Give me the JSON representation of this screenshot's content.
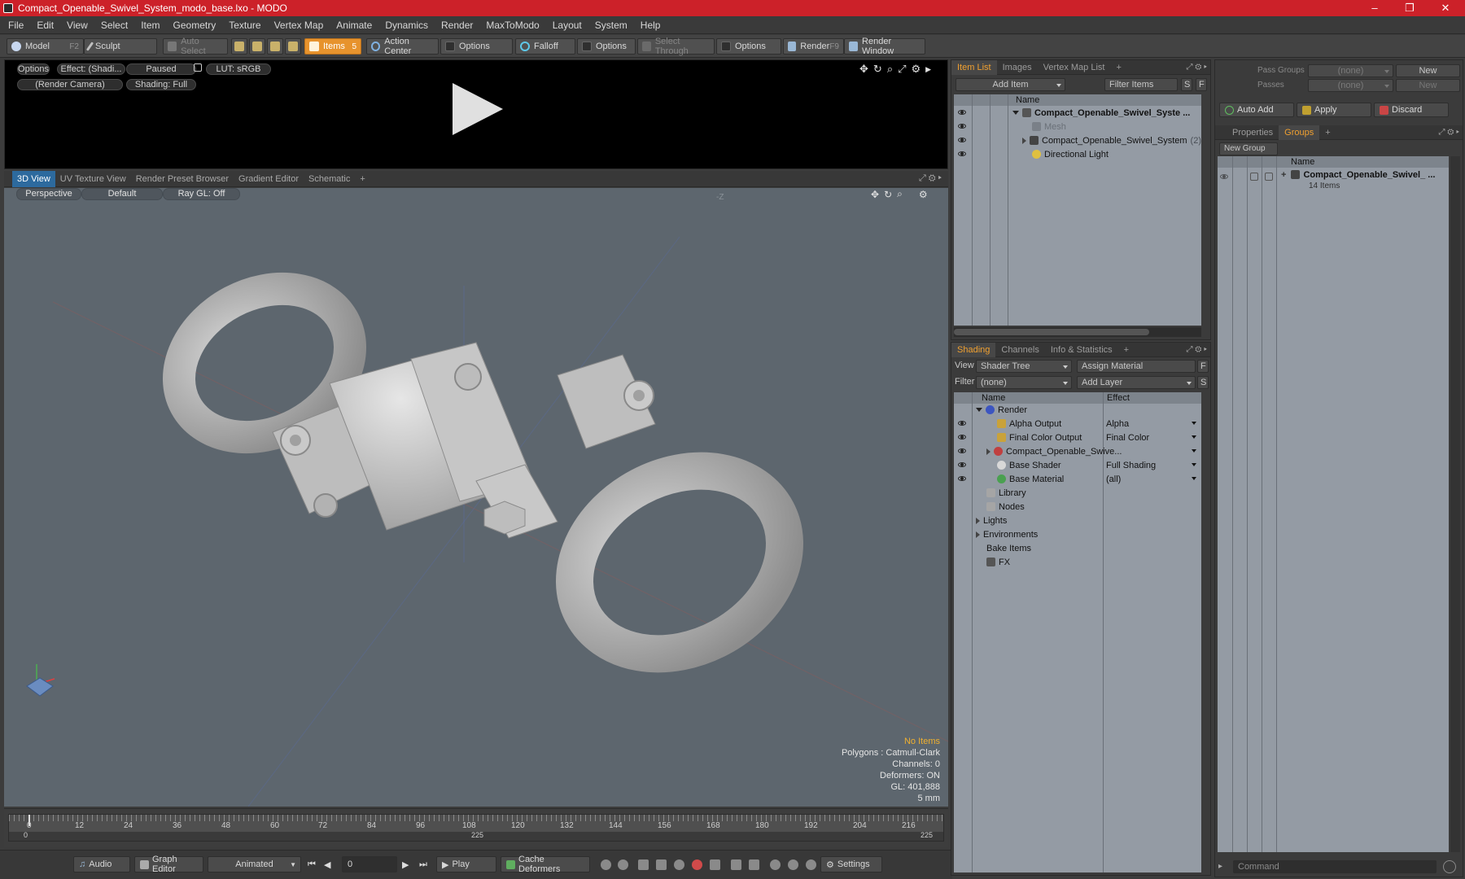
{
  "window": {
    "title": "Compact_Openable_Swivel_System_modo_base.lxo - MODO",
    "controls": [
      "–",
      "❐",
      "✕"
    ]
  },
  "menu": [
    "File",
    "Edit",
    "View",
    "Select",
    "Item",
    "Geometry",
    "Texture",
    "Vertex Map",
    "Animate",
    "Dynamics",
    "Render",
    "MaxToModo",
    "Layout",
    "System",
    "Help"
  ],
  "toolbar": {
    "model": "Model",
    "model_key": "F2",
    "sculpt": "Sculpt",
    "auto_select": "Auto Select",
    "items": "Items",
    "items_key": "5",
    "action_center": "Action Center",
    "options1": "Options",
    "falloff": "Falloff",
    "options2": "Options",
    "select_through": "Select Through",
    "options3": "Options",
    "render": "Render",
    "render_key": "F9",
    "render_window": "Render Window"
  },
  "preview": {
    "options": "Options",
    "effect": "Effect: (Shadi...",
    "paused": "Paused",
    "lut": "LUT: sRGB",
    "camera": "(Render Camera)",
    "shading": "Shading: Full"
  },
  "view_tabs": [
    "3D View",
    "UV Texture View",
    "Render Preset Browser",
    "Gradient Editor",
    "Schematic",
    "+"
  ],
  "viewport": {
    "perspective": "Perspective",
    "default": "Default",
    "raygl": "Ray GL: Off",
    "axis_label": "-Z",
    "stats": {
      "no_items": "No Items",
      "polygons": "Polygons : Catmull-Clark",
      "channels": "Channels: 0",
      "deformers": "Deformers: ON",
      "gl": "GL: 401,888",
      "scale": "5 mm"
    }
  },
  "timeline": {
    "ticks": [
      "0",
      "12",
      "24",
      "36",
      "48",
      "60",
      "72",
      "84",
      "96",
      "108",
      "120",
      "132",
      "144",
      "156",
      "168",
      "180",
      "192",
      "204",
      "216"
    ],
    "start": "0",
    "mid": "225",
    "end": "225"
  },
  "bottom": {
    "audio": "Audio",
    "graph_editor": "Graph Editor",
    "animated": "Animated",
    "frame": "0",
    "play": "Play",
    "cache_deformers": "Cache Deformers",
    "settings": "Settings"
  },
  "item_list": {
    "tabs": [
      "Item List",
      "Images",
      "Vertex Map List",
      "+"
    ],
    "add_item": "Add Item",
    "filter": "Filter Items",
    "s_btn": "S",
    "f_btn": "F",
    "col_name": "Name",
    "rows": [
      {
        "label": "Compact_Openable_Swivel_Syste ...",
        "bold": true
      },
      {
        "label": "Mesh",
        "dim": true
      },
      {
        "label": "Compact_Openable_Swivel_System",
        "count": "(2)"
      },
      {
        "label": "Directional Light"
      }
    ]
  },
  "shading": {
    "tabs": [
      "Shading",
      "Channels",
      "Info & Statistics",
      "+"
    ],
    "view_label": "View",
    "view_value": "Shader Tree",
    "assign_material": "Assign Material",
    "f_btn": "F",
    "filter_label": "Filter",
    "filter_value": "(none)",
    "add_layer": "Add Layer",
    "s_btn": "S",
    "col_name": "Name",
    "col_effect": "Effect",
    "rows": [
      {
        "label": "Render",
        "effect": ""
      },
      {
        "label": "Alpha Output",
        "effect": "Alpha"
      },
      {
        "label": "Final Color Output",
        "effect": "Final Color"
      },
      {
        "label": "Compact_Openable_Swive...",
        "effect": ""
      },
      {
        "label": "Base Shader",
        "effect": "Full Shading"
      },
      {
        "label": "Base Material",
        "effect": "(all)"
      },
      {
        "label": "Library",
        "effect": ""
      },
      {
        "label": "Nodes",
        "effect": ""
      },
      {
        "label": "Lights",
        "effect": ""
      },
      {
        "label": "Environments",
        "effect": ""
      },
      {
        "label": "Bake Items",
        "effect": ""
      },
      {
        "label": "FX",
        "effect": ""
      }
    ]
  },
  "groups_panel": {
    "pass_groups_label": "Pass Groups",
    "pass_groups_value": "(none)",
    "passes_label": "Passes",
    "passes_value": "(none)",
    "new1": "New",
    "new2": "New",
    "auto_add": "Auto Add",
    "apply": "Apply",
    "discard": "Discard",
    "tabs": [
      "Properties",
      "Groups",
      "+"
    ],
    "new_group": "New Group",
    "col_name": "Name",
    "group_name": "Compact_Openable_Swivel_ ...",
    "group_count": "14 Items"
  },
  "command": {
    "placeholder": "Command"
  },
  "colors": {
    "titlebar": "#cc2129",
    "accent_orange": "#e7932d",
    "viewport_bg": "#5d666e",
    "list_bg": "#949ba4"
  }
}
